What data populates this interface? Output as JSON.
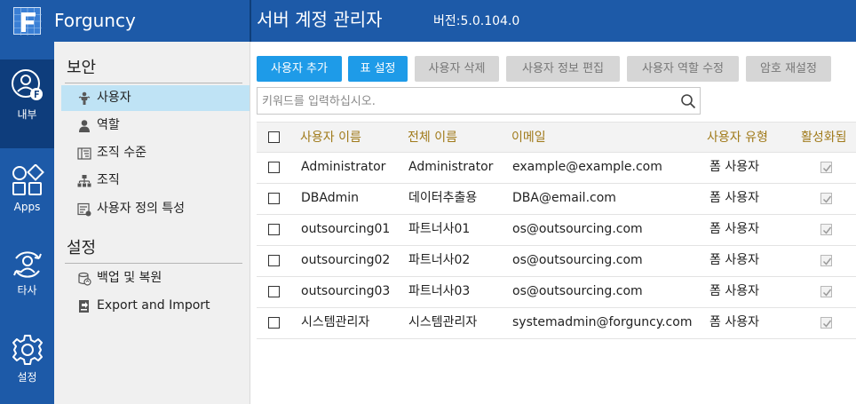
{
  "header": {
    "app_name": "Forguncy",
    "page_title": "서버 계정 관리자",
    "version": "버전:5.0.104.0",
    "brand_color": "#1d5aa8"
  },
  "rail": [
    {
      "label": "내부",
      "icon": "user-f-icon",
      "active": true
    },
    {
      "label": "Apps",
      "icon": "apps-icon",
      "active": false
    },
    {
      "label": "타사",
      "icon": "third-party-user-icon",
      "active": false
    },
    {
      "label": "설정",
      "icon": "gear-icon",
      "active": false
    }
  ],
  "sidenav": {
    "security_title": "보안",
    "security_items": [
      {
        "label": "사용자",
        "icon": "user-person-icon",
        "selected": true
      },
      {
        "label": "역할",
        "icon": "role-icon",
        "selected": false
      },
      {
        "label": "조직 수준",
        "icon": "org-level-icon",
        "selected": false
      },
      {
        "label": "조직",
        "icon": "org-tree-icon",
        "selected": false
      },
      {
        "label": "사용자 정의 특성",
        "icon": "custom-property-icon",
        "selected": false
      }
    ],
    "settings_title": "설정",
    "settings_items": [
      {
        "label": "백업 및 복원",
        "icon": "backup-restore-icon"
      },
      {
        "label": "Export and Import",
        "icon": "export-import-icon"
      }
    ]
  },
  "toolbar": {
    "add_user": "사용자 추가",
    "table_settings": "표 설정",
    "delete_user": "사용자 삭제",
    "edit_user_info": "사용자 정보 편집",
    "edit_user_roles": "사용자 역할 수정",
    "reset_password": "암호 재설정"
  },
  "search": {
    "placeholder": "키워드를 입력하십시오.",
    "value": ""
  },
  "table": {
    "columns": [
      "사용자 이름",
      "전체 이름",
      "이메일",
      "사용자 유형",
      "활성화됨"
    ],
    "rows": [
      {
        "username": "Administrator",
        "fullname": "Administrator",
        "email": "example@example.com",
        "type": "폼 사용자",
        "enabled": true
      },
      {
        "username": "DBAdmin",
        "fullname": "데이터추출용",
        "email": "DBA@email.com",
        "type": "폼 사용자",
        "enabled": true
      },
      {
        "username": "outsourcing01",
        "fullname": "파트너사01",
        "email": "os@outsourcing.com",
        "type": "폼 사용자",
        "enabled": true
      },
      {
        "username": "outsourcing02",
        "fullname": "파트너사02",
        "email": "os@outsourcing.com",
        "type": "폼 사용자",
        "enabled": true
      },
      {
        "username": "outsourcing03",
        "fullname": "파트너사03",
        "email": "os@outsourcing.com",
        "type": "폼 사용자",
        "enabled": true
      },
      {
        "username": "시스템관리자",
        "fullname": "시스템관리자",
        "email": "systemadmin@forguncy.com",
        "type": "폼 사용자",
        "enabled": true
      }
    ]
  },
  "colors": {
    "primary_button": "#1e9be8",
    "disabled_button": "#d6d6d6",
    "column_header_text": "#a07a1a",
    "selected_nav": "#bfe3f5"
  }
}
